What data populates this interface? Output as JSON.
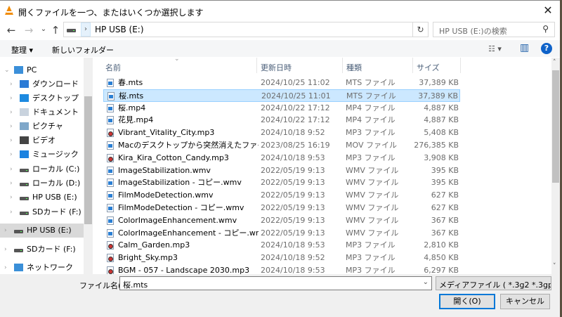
{
  "window": {
    "title": "開くファイルを一つ、またはいくつか選択します",
    "close": "✕"
  },
  "nav": {
    "back": "←",
    "forward": "→",
    "recent": "⌄",
    "up": "↑",
    "address": "HP USB (E:)",
    "chevron": "›",
    "refresh": "↻",
    "search_placeholder": "HP USB (E:)の検索",
    "search_icon": "⚲"
  },
  "toolbar": {
    "organize": "整理 ▾",
    "new_folder": "新しいフォルダー",
    "view": "☷ ▾",
    "pane": "▥",
    "help": "?"
  },
  "sidebar": {
    "items": [
      {
        "label": "PC",
        "icon": "pc-icon",
        "chev": "⌄"
      },
      {
        "label": "ダウンロード",
        "icon": "download-icon",
        "chev": "›"
      },
      {
        "label": "デスクトップ",
        "icon": "desktop-icon",
        "chev": "›"
      },
      {
        "label": "ドキュメント",
        "icon": "documents-icon",
        "chev": "›"
      },
      {
        "label": "ピクチャ",
        "icon": "pictures-icon",
        "chev": "›"
      },
      {
        "label": "ビデオ",
        "icon": "videos-icon",
        "chev": "›"
      },
      {
        "label": "ミュージック",
        "icon": "music-icon",
        "chev": "›"
      },
      {
        "label": "ローカル (C:)",
        "icon": "drive-icon",
        "chev": "›"
      },
      {
        "label": "ローカル (D:)",
        "icon": "drive-icon",
        "chev": "›"
      },
      {
        "label": "HP USB (E:)",
        "icon": "drive-icon",
        "chev": "›"
      },
      {
        "label": "SDカード (F:)",
        "icon": "drive-icon",
        "chev": "›"
      },
      {
        "label": "HP USB (E:)",
        "icon": "drive-icon",
        "chev": "›"
      },
      {
        "label": "SDカード (F:)",
        "icon": "drive-icon",
        "chev": "›"
      },
      {
        "label": "ネットワーク",
        "icon": "network-icon",
        "chev": "›"
      }
    ]
  },
  "columns": {
    "name": "名前",
    "date": "更新日時",
    "type": "種類",
    "size": "サイズ",
    "sort": "⌄"
  },
  "files": [
    {
      "name": "春.mts",
      "date": "2024/10/25 11:02",
      "type": "MTS ファイル",
      "size": "37,389 KB",
      "kind": "video"
    },
    {
      "name": "桜.mts",
      "date": "2024/10/25 11:01",
      "type": "MTS ファイル",
      "size": "37,389 KB",
      "kind": "video",
      "selected": true
    },
    {
      "name": "桜.mp4",
      "date": "2024/10/22 17:12",
      "type": "MP4 ファイル",
      "size": "4,887 KB",
      "kind": "video"
    },
    {
      "name": "花見.mp4",
      "date": "2024/10/22 17:12",
      "type": "MP4 ファイル",
      "size": "4,887 KB",
      "kind": "video"
    },
    {
      "name": "Vibrant_Vitality_City.mp3",
      "date": "2024/10/18 9:52",
      "type": "MP3 ファイル",
      "size": "5,408 KB",
      "kind": "audio"
    },
    {
      "name": "Macのデスクトップから突然消えたファイルを復...",
      "date": "2023/08/25 16:19",
      "type": "MOV ファイル",
      "size": "276,385 KB",
      "kind": "video"
    },
    {
      "name": "Kira_Kira_Cotton_Candy.mp3",
      "date": "2024/10/18 9:53",
      "type": "MP3 ファイル",
      "size": "3,908 KB",
      "kind": "audio"
    },
    {
      "name": "ImageStabilization.wmv",
      "date": "2022/05/19 9:13",
      "type": "WMV ファイル",
      "size": "395 KB",
      "kind": "video"
    },
    {
      "name": "ImageStabilization - コピー.wmv",
      "date": "2022/05/19 9:13",
      "type": "WMV ファイル",
      "size": "395 KB",
      "kind": "video"
    },
    {
      "name": "FilmModeDetection.wmv",
      "date": "2022/05/19 9:13",
      "type": "WMV ファイル",
      "size": "627 KB",
      "kind": "video"
    },
    {
      "name": "FilmModeDetection - コピー.wmv",
      "date": "2022/05/19 9:13",
      "type": "WMV ファイル",
      "size": "627 KB",
      "kind": "video"
    },
    {
      "name": "ColorImageEnhancement.wmv",
      "date": "2022/05/19 9:13",
      "type": "WMV ファイル",
      "size": "367 KB",
      "kind": "video"
    },
    {
      "name": "ColorImageEnhancement - コピー.wmv",
      "date": "2022/05/19 9:13",
      "type": "WMV ファイル",
      "size": "367 KB",
      "kind": "video"
    },
    {
      "name": "Calm_Garden.mp3",
      "date": "2024/10/18 9:53",
      "type": "MP3 ファイル",
      "size": "2,810 KB",
      "kind": "audio"
    },
    {
      "name": "Bright_Sky.mp3",
      "date": "2024/10/18 9:52",
      "type": "MP3 ファイル",
      "size": "4,850 KB",
      "kind": "audio"
    },
    {
      "name": "BGM - 057 - Landscape 2030.mp3",
      "date": "2024/10/18 9:53",
      "type": "MP3 ファイル",
      "size": "6,297 KB",
      "kind": "audio"
    }
  ],
  "bottom": {
    "filename_label": "ファイル名(N):",
    "filename_value": "桜.mts",
    "filter": "メディアファイル ( *.3g2 *.3gp *.3gp",
    "open": "開く(O)",
    "cancel": "キャンセル",
    "dropdown": "⌄"
  },
  "colors": {
    "selection": "#cce8ff",
    "accent": "#0078d7",
    "vlc": "#f08a00"
  }
}
